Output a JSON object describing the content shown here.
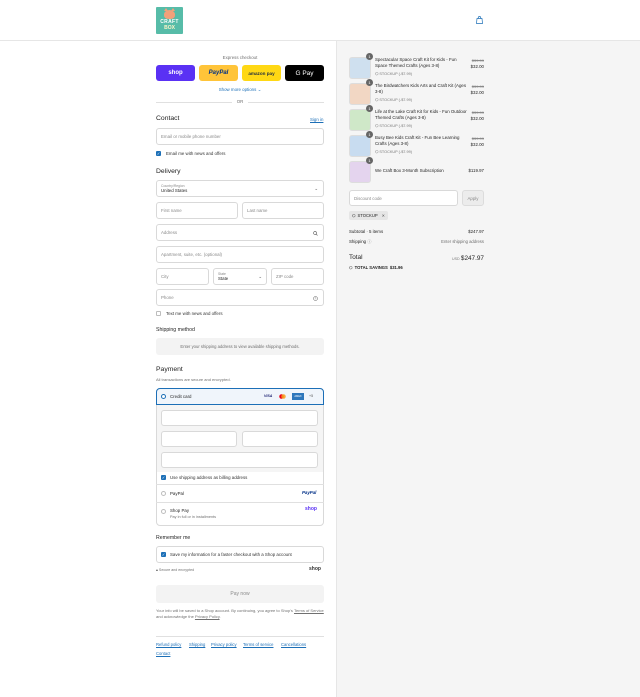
{
  "header": {
    "logo_line1": "CRAFT",
    "logo_line2": "BOX",
    "cart_icon": "shopping-bag-icon"
  },
  "express": {
    "title": "Express checkout",
    "shop": "shop",
    "paypal": "PayPal",
    "amazon": "amazon pay",
    "gpay": "G Pay",
    "show_more": "Show more options",
    "or": "OR"
  },
  "contact": {
    "heading": "Contact",
    "sign_in": "Sign in",
    "email_placeholder": "Email or mobile phone number",
    "email_news": "Email me with news and offers"
  },
  "delivery": {
    "heading": "Delivery",
    "country_label": "Country/Region",
    "country_value": "United States",
    "first_name": "First name",
    "last_name": "Last name",
    "address": "Address",
    "apartment": "Apartment, suite, etc. (optional)",
    "city": "City",
    "state_label": "State",
    "state_value": "State",
    "zip": "ZIP code",
    "phone": "Phone",
    "text_news": "Text me with news and offers"
  },
  "shipping_method": {
    "heading": "Shipping method",
    "notice": "Enter your shipping address to view available shipping methods."
  },
  "payment": {
    "heading": "Payment",
    "subtitle": "All transactions are secure and encrypted.",
    "credit_card": "Credit card",
    "cards": [
      "VISA",
      "MC",
      "AMEX",
      "+5"
    ],
    "billing_same": "Use shipping address as billing address",
    "paypal": "PayPal",
    "paypal_logo": "PayPal",
    "shop_pay": "Shop Pay",
    "shop_pay_sub": "Pay in full or in installments",
    "shop_logo": "shop"
  },
  "remember": {
    "heading": "Remember me",
    "save_info": "Save my information for a faster checkout with a Shop account",
    "secure": "Secure and encrypted",
    "shop_logo": "shop"
  },
  "pay_now": "Pay now",
  "legal": {
    "line1": "Your info will be saved to a Shop account. By continuing, you agree to Shop's",
    "terms": "Terms of Service",
    "and": "and acknowledge the",
    "privacy": "Privacy Policy",
    "period": "."
  },
  "footer_links": [
    "Refund policy",
    "Shipping",
    "Privacy policy",
    "Terms of service",
    "Cancellations",
    "Contact"
  ],
  "order": {
    "items": [
      {
        "qty": "1",
        "name": "Spectacular Space Craft Kit for Kids - Fun Space Themed Crafts (Ages 3-8)",
        "code": "STOCKUP (-$7.99)",
        "was": "$39.99",
        "price": "$32.00"
      },
      {
        "qty": "1",
        "name": "The Birdwatchers Kids Arts and Craft Kit (Ages 3-8)",
        "code": "STOCKUP (-$7.99)",
        "was": "$39.99",
        "price": "$32.00"
      },
      {
        "qty": "1",
        "name": "Life at the Lake Craft Kit for Kids - Fun Outdoor Themed Crafts (Ages 3-8)",
        "code": "STOCKUP (-$7.99)",
        "was": "$39.99",
        "price": "$32.00"
      },
      {
        "qty": "1",
        "name": "Busy Bee Kids Craft Kit - Fun Bee Learning Crafts (Ages 3-8)",
        "code": "STOCKUP (-$7.99)",
        "was": "$39.99",
        "price": "$32.00"
      },
      {
        "qty": "1",
        "name": "We Craft Box 3-Month Subscription",
        "code": "",
        "was": "",
        "price": "$119.97"
      }
    ],
    "discount_placeholder": "Discount code",
    "apply": "Apply",
    "applied_code": "STOCKUP",
    "subtotal_label": "Subtotal · 5 items",
    "subtotal": "$247.97",
    "shipping_label": "Shipping",
    "shipping_value": "Enter shipping address",
    "total_label": "Total",
    "currency": "USD",
    "total": "$247.97",
    "savings_label": "TOTAL SAVINGS",
    "savings": "$31.96"
  }
}
